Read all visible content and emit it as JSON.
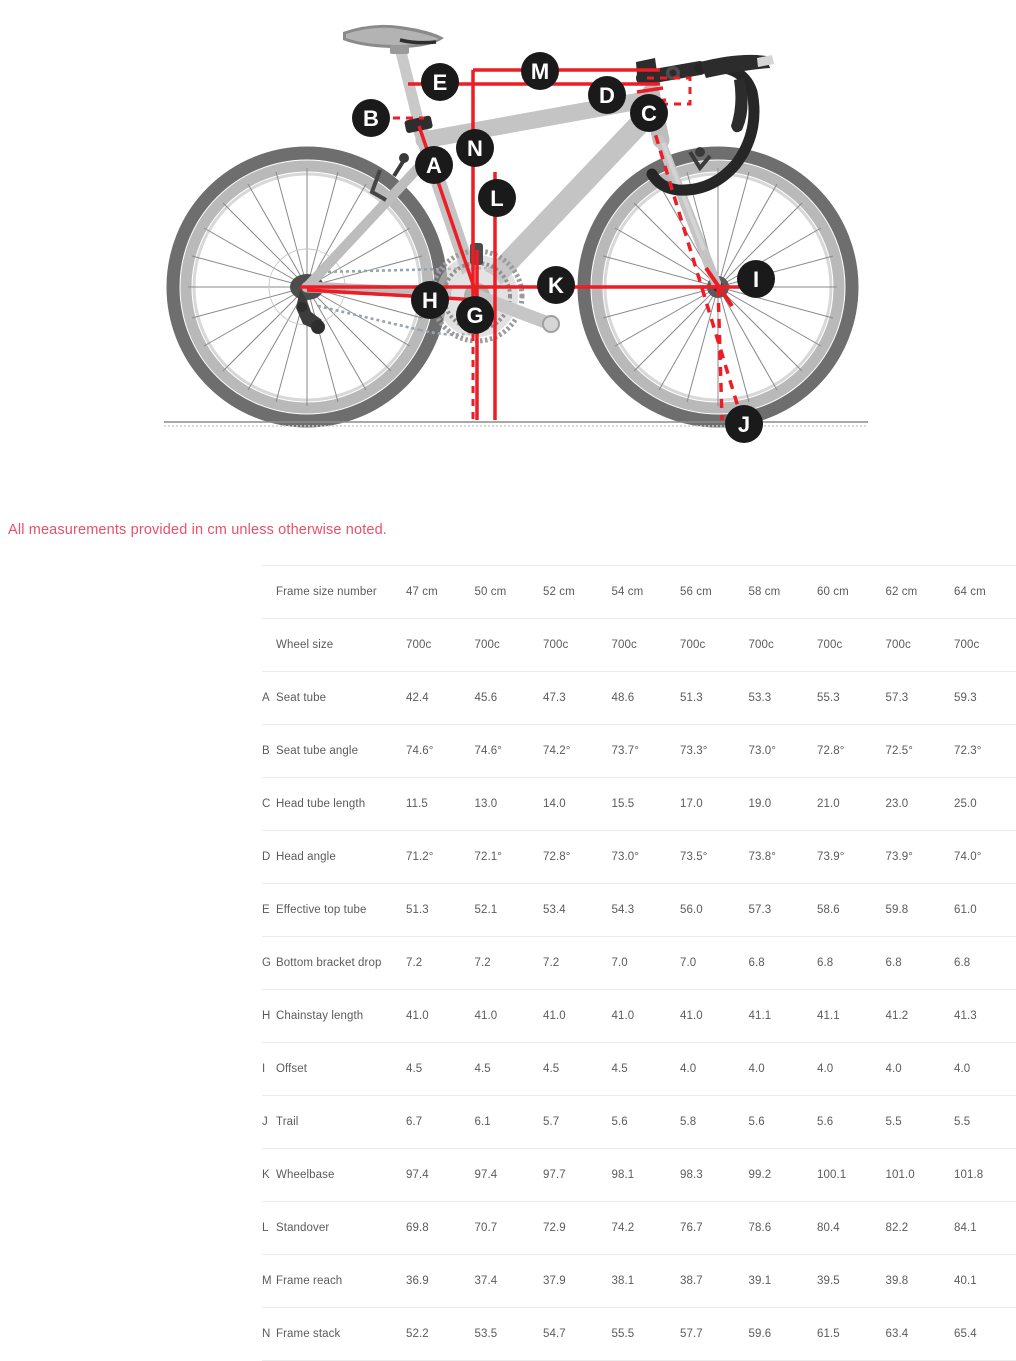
{
  "page": {
    "note": "All measurements provided in cm unless otherwise noted."
  },
  "diagram": {
    "name": "road-bike-geometry-diagram",
    "ground_line": true,
    "callouts": [
      {
        "id": "A",
        "label": "A",
        "meaning": "Seat tube"
      },
      {
        "id": "B",
        "label": "B",
        "meaning": "Seat tube angle"
      },
      {
        "id": "C",
        "label": "C",
        "meaning": "Head tube length"
      },
      {
        "id": "D",
        "label": "D",
        "meaning": "Head angle"
      },
      {
        "id": "E",
        "label": "E",
        "meaning": "Effective top tube"
      },
      {
        "id": "G",
        "label": "G",
        "meaning": "Bottom bracket drop"
      },
      {
        "id": "H",
        "label": "H",
        "meaning": "Chainstay length"
      },
      {
        "id": "I",
        "label": "I",
        "meaning": "Offset"
      },
      {
        "id": "J",
        "label": "J",
        "meaning": "Trail"
      },
      {
        "id": "K",
        "label": "K",
        "meaning": "Wheelbase"
      },
      {
        "id": "L",
        "label": "L",
        "meaning": "Standover"
      },
      {
        "id": "M",
        "label": "M",
        "meaning": "Frame reach"
      },
      {
        "id": "N",
        "label": "N",
        "meaning": "Frame stack"
      }
    ]
  },
  "colors": {
    "note_red": "#e8516a",
    "diagram_red": "#ee1c25",
    "badge_black": "#1a1a1a",
    "frame_gray": "#bfbfbf",
    "tire_dark": "#6e6e6e",
    "row_divider": "#ececec"
  },
  "table": {
    "rows": [
      {
        "letter": "",
        "label": "Frame size number",
        "values": [
          "47 cm",
          "50 cm",
          "52 cm",
          "54 cm",
          "56 cm",
          "58 cm",
          "60 cm",
          "62 cm",
          "64 cm"
        ]
      },
      {
        "letter": "",
        "label": "Wheel size",
        "values": [
          "700c",
          "700c",
          "700c",
          "700c",
          "700c",
          "700c",
          "700c",
          "700c",
          "700c"
        ]
      },
      {
        "letter": "A",
        "label": "Seat tube",
        "values": [
          "42.4",
          "45.6",
          "47.3",
          "48.6",
          "51.3",
          "53.3",
          "55.3",
          "57.3",
          "59.3"
        ]
      },
      {
        "letter": "B",
        "label": "Seat tube angle",
        "values": [
          "74.6°",
          "74.6°",
          "74.2°",
          "73.7°",
          "73.3°",
          "73.0°",
          "72.8°",
          "72.5°",
          "72.3°"
        ]
      },
      {
        "letter": "C",
        "label": "Head tube length",
        "values": [
          "11.5",
          "13.0",
          "14.0",
          "15.5",
          "17.0",
          "19.0",
          "21.0",
          "23.0",
          "25.0"
        ]
      },
      {
        "letter": "D",
        "label": "Head angle",
        "values": [
          "71.2°",
          "72.1°",
          "72.8°",
          "73.0°",
          "73.5°",
          "73.8°",
          "73.9°",
          "73.9°",
          "74.0°"
        ]
      },
      {
        "letter": "E",
        "label": "Effective top tube",
        "values": [
          "51.3",
          "52.1",
          "53.4",
          "54.3",
          "56.0",
          "57.3",
          "58.6",
          "59.8",
          "61.0"
        ]
      },
      {
        "letter": "G",
        "label": "Bottom bracket drop",
        "values": [
          "7.2",
          "7.2",
          "7.2",
          "7.0",
          "7.0",
          "6.8",
          "6.8",
          "6.8",
          "6.8"
        ]
      },
      {
        "letter": "H",
        "label": "Chainstay length",
        "values": [
          "41.0",
          "41.0",
          "41.0",
          "41.0",
          "41.0",
          "41.1",
          "41.1",
          "41.2",
          "41.3"
        ]
      },
      {
        "letter": "I",
        "label": "Offset",
        "values": [
          "4.5",
          "4.5",
          "4.5",
          "4.5",
          "4.0",
          "4.0",
          "4.0",
          "4.0",
          "4.0"
        ]
      },
      {
        "letter": "J",
        "label": "Trail",
        "values": [
          "6.7",
          "6.1",
          "5.7",
          "5.6",
          "5.8",
          "5.6",
          "5.6",
          "5.5",
          "5.5"
        ]
      },
      {
        "letter": "K",
        "label": "Wheelbase",
        "values": [
          "97.4",
          "97.4",
          "97.7",
          "98.1",
          "98.3",
          "99.2",
          "100.1",
          "101.0",
          "101.8"
        ]
      },
      {
        "letter": "L",
        "label": "Standover",
        "values": [
          "69.8",
          "70.7",
          "72.9",
          "74.2",
          "76.7",
          "78.6",
          "80.4",
          "82.2",
          "84.1"
        ]
      },
      {
        "letter": "M",
        "label": "Frame reach",
        "values": [
          "36.9",
          "37.4",
          "37.9",
          "38.1",
          "38.7",
          "39.1",
          "39.5",
          "39.8",
          "40.1"
        ]
      },
      {
        "letter": "N",
        "label": "Frame stack",
        "values": [
          "52.2",
          "53.5",
          "54.7",
          "55.5",
          "57.7",
          "59.6",
          "61.5",
          "63.4",
          "65.4"
        ]
      }
    ]
  }
}
